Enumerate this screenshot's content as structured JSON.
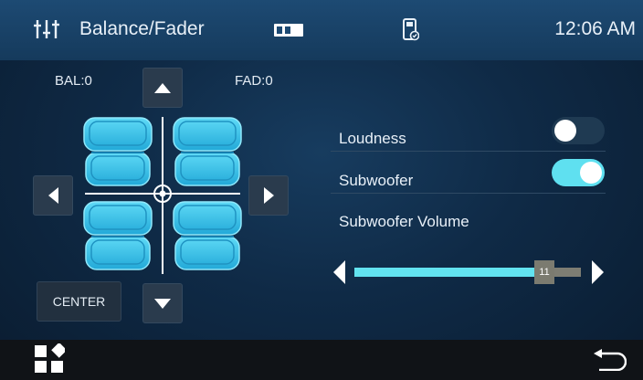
{
  "header": {
    "title": "Balance/Fader",
    "time": "12:06 AM",
    "icons": [
      "equalizer-icon",
      "battery-icon",
      "phone-link-icon"
    ]
  },
  "balance_fader": {
    "bal_label": "BAL:0",
    "fad_label": "FAD:0",
    "center_button": "CENTER",
    "seat_color": "#39c4ec"
  },
  "settings": {
    "loudness": {
      "label": "Loudness",
      "on": false
    },
    "subwoofer": {
      "label": "Subwoofer",
      "on": true
    },
    "subwoofer_volume": {
      "label": "Subwoofer Volume",
      "value": "11",
      "fraction": 0.84
    }
  },
  "footer": {
    "icons": [
      "apps-grid-icon",
      "back-icon"
    ]
  },
  "colors": {
    "accent": "#5fe0f0",
    "toggle_off": "#1f3a52",
    "topbar": "#1d4a73"
  }
}
